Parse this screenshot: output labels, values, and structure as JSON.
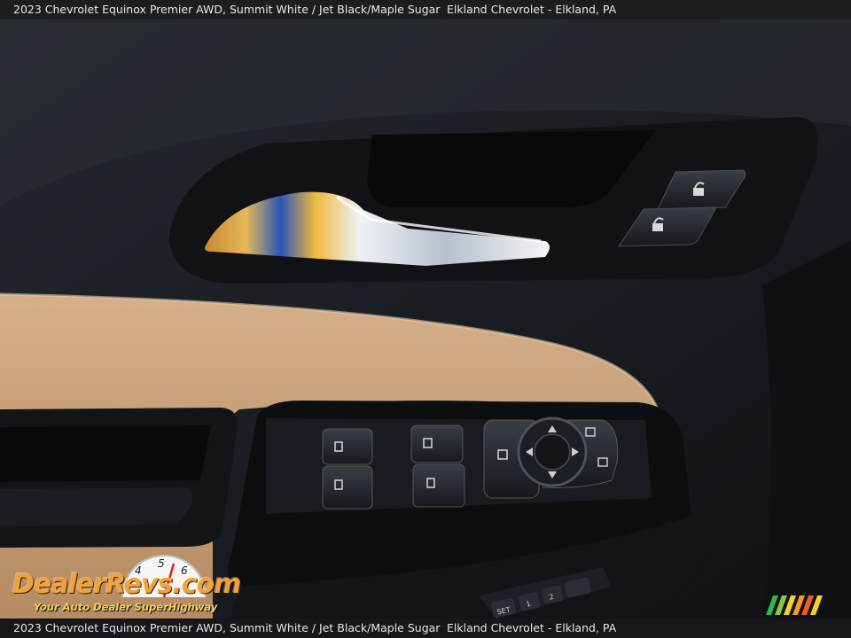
{
  "caption": {
    "top_left": "2023 Chevrolet Equinox Premier AWD,  Summit White / Jet Black/Maple Sugar",
    "top_right": "Elkland Chevrolet - Elkland, PA",
    "bottom_left": "2023 Chevrolet Equinox Premier AWD,  Summit White / Jet Black/Maple Sugar",
    "bottom_right": "Elkland Chevrolet - Elkland, PA"
  },
  "watermark": {
    "brand": "DealerRevs.com",
    "tagline": "Your Auto Dealer SuperHighway"
  },
  "colors": {
    "caption_bg": "#1b1d20",
    "panel_black": "#15181c",
    "leather_tan": "#c9a27c",
    "chrome": "#dfe4ea",
    "logo_orange": "#f2a23a"
  },
  "icons": [
    "speedometer-icon",
    "rainbow-stripes-icon",
    "lock-icon",
    "unlock-icon",
    "window-switch-icon",
    "mirror-control-icon"
  ],
  "switch_labels": {
    "set": "SET",
    "memory_1": "1",
    "memory_2": "2"
  }
}
